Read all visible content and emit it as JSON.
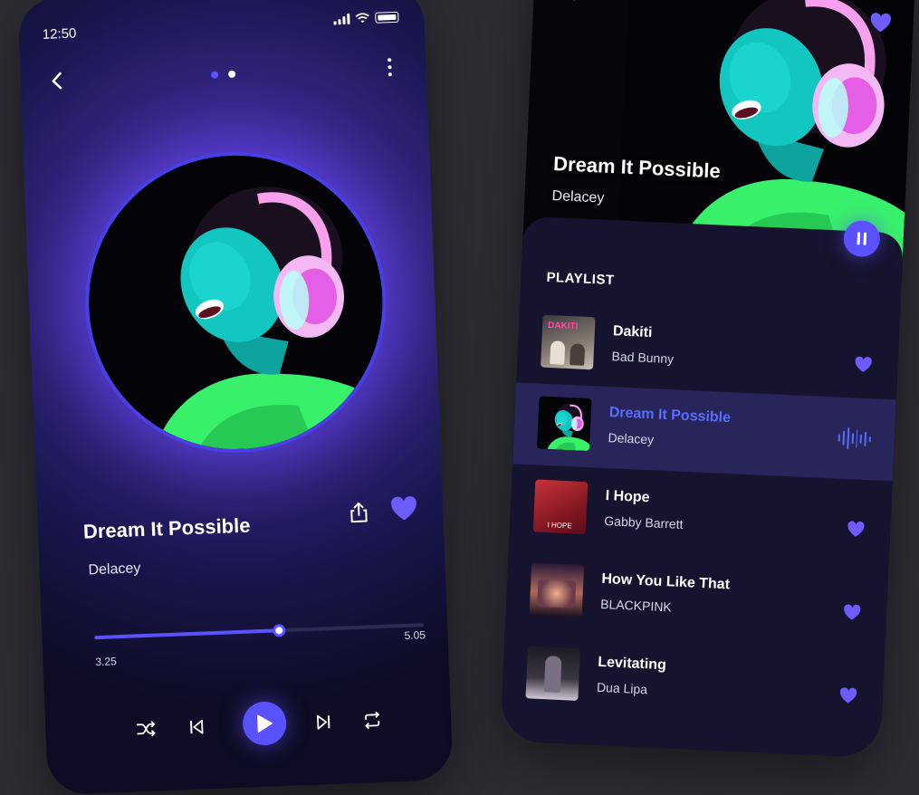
{
  "status": {
    "time": "12:50"
  },
  "now_playing": {
    "title": "Dream It Possible",
    "artist": "Delacey",
    "current_time": "3.25",
    "total_time": "5.05",
    "progress": 0.56
  },
  "pager": {
    "count": 2,
    "active_index": 0
  },
  "colors": {
    "accent": "#5b52ff",
    "accent_text": "#5b6dff",
    "background": "#2e2d34",
    "sheet": "#15132d",
    "active_row": "#27255a"
  },
  "icons": {
    "back": "chevron-left-icon",
    "more": "more-vertical-icon",
    "share": "share-icon",
    "favorite": "heart-icon",
    "shuffle": "shuffle-icon",
    "previous": "skip-previous-icon",
    "play": "play-icon",
    "next": "skip-next-icon",
    "repeat": "repeat-icon",
    "pause": "pause-icon",
    "waveform": "waveform-icon"
  },
  "playlist": {
    "heading": "PLAYLIST",
    "items": [
      {
        "title": "Dakiti",
        "artist": "Bad Bunny",
        "cover_text": "DAKITI",
        "active": false
      },
      {
        "title": "Dream It Possible",
        "artist": "Delacey",
        "cover_text": "",
        "active": true
      },
      {
        "title": "I Hope",
        "artist": "Gabby Barrett",
        "cover_text": "I HOPE",
        "active": false
      },
      {
        "title": "How You Like That",
        "artist": "BLACKPINK",
        "cover_text": "",
        "active": false
      },
      {
        "title": "Levitating",
        "artist": "Dua Lipa",
        "cover_text": "",
        "active": false
      }
    ]
  }
}
